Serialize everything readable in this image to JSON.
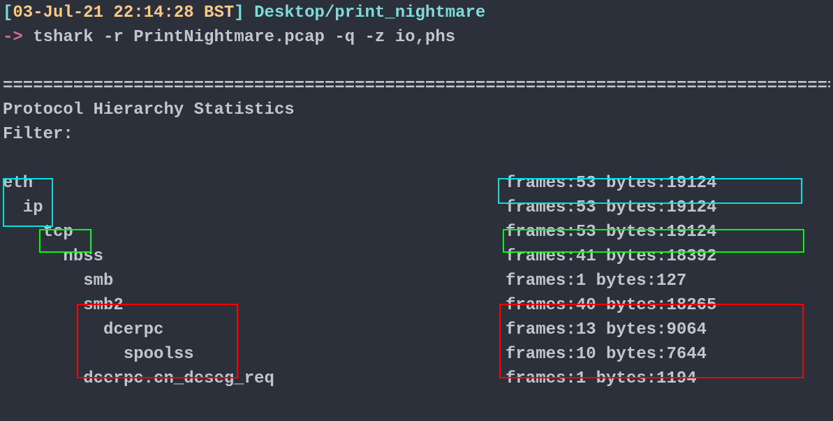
{
  "prompt": {
    "open_bracket": "[",
    "timestamp": "03-Jul-21 22:14:28 BST",
    "close_bracket": "]",
    "path": " Desktop/print_nightmare",
    "arrow": "->",
    "dollar": " ",
    "command": "tshark -r PrintNightmare.pcap -q -z io,phs"
  },
  "output": {
    "rule": "===================================================================================",
    "title": "Protocol Hierarchy Statistics",
    "filter_label": "Filter:",
    "rows": [
      {
        "indent": "",
        "proto": "eth",
        "frames": "53",
        "bytes": "19124"
      },
      {
        "indent": "  ",
        "proto": "ip",
        "frames": "53",
        "bytes": "19124"
      },
      {
        "indent": "    ",
        "proto": "tcp",
        "frames": "53",
        "bytes": "19124"
      },
      {
        "indent": "      ",
        "proto": "nbss",
        "frames": "41",
        "bytes": "18392"
      },
      {
        "indent": "        ",
        "proto": "smb",
        "frames": "1",
        "bytes": "127"
      },
      {
        "indent": "        ",
        "proto": "smb2",
        "frames": "40",
        "bytes": "18265"
      },
      {
        "indent": "          ",
        "proto": "dcerpc",
        "frames": "13",
        "bytes": "9064"
      },
      {
        "indent": "            ",
        "proto": "spoolss",
        "frames": "10",
        "bytes": "7644"
      },
      {
        "indent": "        ",
        "proto": "dcerpc.cn_deseg_req",
        "frames": "1",
        "bytes": "1194"
      }
    ]
  }
}
